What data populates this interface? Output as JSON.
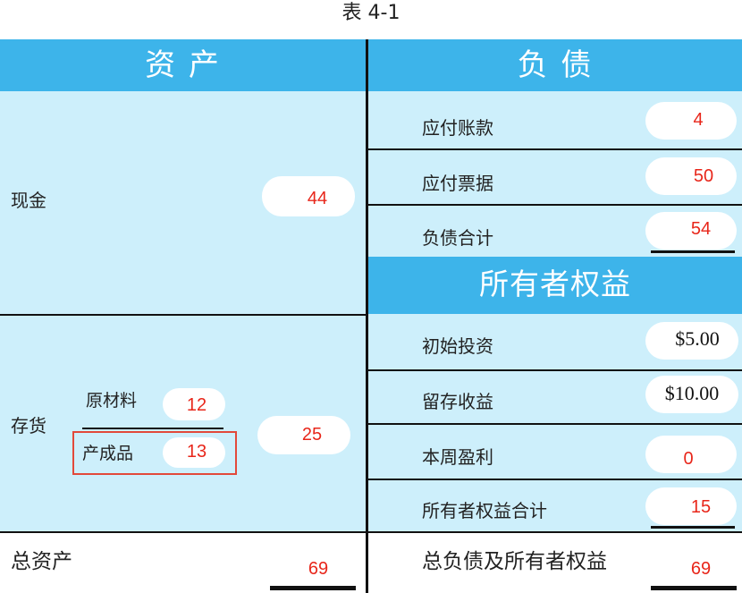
{
  "title": "表   4-1",
  "assets": {
    "header": "资  产",
    "cash_label": "现金",
    "cash_value": "44",
    "inventory_label": "存货",
    "raw_label": "原材料",
    "raw_value": "12",
    "finished_label": "产成品",
    "finished_value": "13",
    "inventory_value": "25",
    "total_label": "总资产",
    "total_value": "69"
  },
  "liabilities": {
    "header": "负  债",
    "rows": [
      {
        "label": "应付账款",
        "value": "4"
      },
      {
        "label": "应付票据",
        "value": "50"
      },
      {
        "label": "负债合计",
        "value": "54"
      }
    ]
  },
  "equity": {
    "header": "所有者权益",
    "rows": [
      {
        "label": "初始投资",
        "value": "$5.00"
      },
      {
        "label": "留存收益",
        "value": "$10.00"
      },
      {
        "label": "本周盈利",
        "value": "0"
      },
      {
        "label": "所有者权益合计",
        "value": "15"
      }
    ],
    "total_label": "总负债及所有者权益",
    "total_value": "69"
  },
  "colors": {
    "header_blue": "#3db4ea",
    "light_blue": "#cdeffb",
    "red_value": "#e8261a",
    "highlight_box": "#e2493a"
  }
}
